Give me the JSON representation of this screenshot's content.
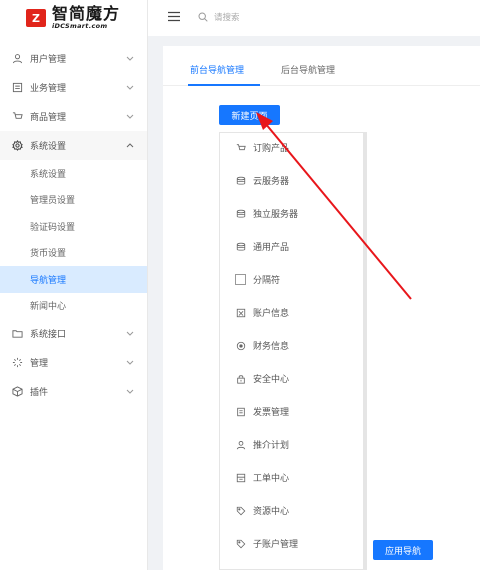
{
  "brand": {
    "mark": "Z",
    "name_cn": "智简魔方",
    "name_en": "iDCSmart.com"
  },
  "search": {
    "placeholder": "请搜索"
  },
  "sidebar": {
    "items": [
      {
        "label": "用户管理",
        "icon": "user-icon"
      },
      {
        "label": "业务管理",
        "icon": "business-icon"
      },
      {
        "label": "商品管理",
        "icon": "cart-icon"
      },
      {
        "label": "系统设置",
        "icon": "settings-icon"
      },
      {
        "label": "系统接口",
        "icon": "folder-icon"
      },
      {
        "label": "管理",
        "icon": "manage-icon"
      },
      {
        "label": "插件",
        "icon": "plugin-icon"
      }
    ],
    "sub_items": [
      {
        "label": "系统设置"
      },
      {
        "label": "管理员设置"
      },
      {
        "label": "验证码设置"
      },
      {
        "label": "货币设置"
      },
      {
        "label": "导航管理"
      },
      {
        "label": "新闻中心"
      }
    ]
  },
  "tabs": [
    {
      "label": "前台导航管理"
    },
    {
      "label": "后台导航管理"
    }
  ],
  "buttons": {
    "new_page": "新建页面",
    "apply_nav": "应用导航"
  },
  "nav_list": [
    {
      "label": "订购产品",
      "icon": "cart-icon"
    },
    {
      "label": "云服务器",
      "icon": "database-icon"
    },
    {
      "label": "独立服务器",
      "icon": "database-icon"
    },
    {
      "label": "通用产品",
      "icon": "database-icon"
    },
    {
      "label": "分隔符",
      "icon": "divider-box-icon"
    },
    {
      "label": "账户信息",
      "icon": "account-icon"
    },
    {
      "label": "财务信息",
      "icon": "finance-icon"
    },
    {
      "label": "安全中心",
      "icon": "lock-icon"
    },
    {
      "label": "发票管理",
      "icon": "invoice-icon"
    },
    {
      "label": "推介计划",
      "icon": "user-icon"
    },
    {
      "label": "工单中心",
      "icon": "ticket-icon"
    },
    {
      "label": "资源中心",
      "icon": "tag-icon"
    },
    {
      "label": "子账户管理",
      "icon": "tag-icon"
    }
  ],
  "colors": {
    "primary": "#1677ff",
    "brand_red": "#e1251b",
    "annotation_red": "#e8161b"
  }
}
